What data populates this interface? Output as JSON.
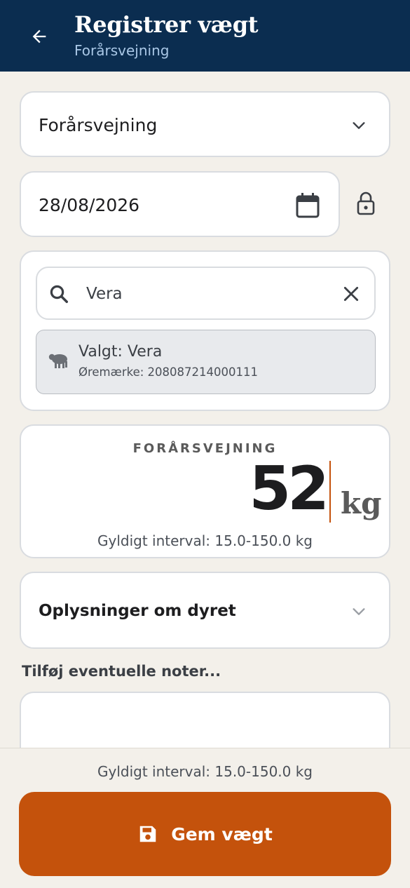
{
  "header": {
    "title": "Registrer vægt",
    "subtitle": "Forårsvejning",
    "back_icon": "arrow-left-icon"
  },
  "weighing_type": {
    "selected": "Forårsvejning",
    "icon": "chevron-down-icon"
  },
  "date": {
    "value": "28/08/2026",
    "icon": "calendar-icon",
    "lock_icon": "lock-icon"
  },
  "animal_search": {
    "query": "Vera",
    "search_icon": "search-icon",
    "clear_icon": "close-icon",
    "selected_label": "Valgt: Vera",
    "ear_tag": "Øremærke: 208087214000111",
    "animal_icon": "sheep-icon"
  },
  "weight": {
    "label": "FORÅRSVEJNING",
    "value": "52",
    "unit": "kg",
    "range": "Gyldigt interval: 15.0-150.0 kg"
  },
  "animal_info": {
    "label": "Oplysninger om dyret"
  },
  "notes": {
    "label": "Tilføj eventuelle noter...",
    "value": ""
  },
  "footer": {
    "range": "Gyldigt interval: 15.0-150.0 kg",
    "save_label": "Gem vægt",
    "save_icon": "save-icon"
  },
  "colors": {
    "header_bg": "#0b2d50",
    "accent": "#c4520c",
    "page_bg": "#f3f0ea"
  }
}
